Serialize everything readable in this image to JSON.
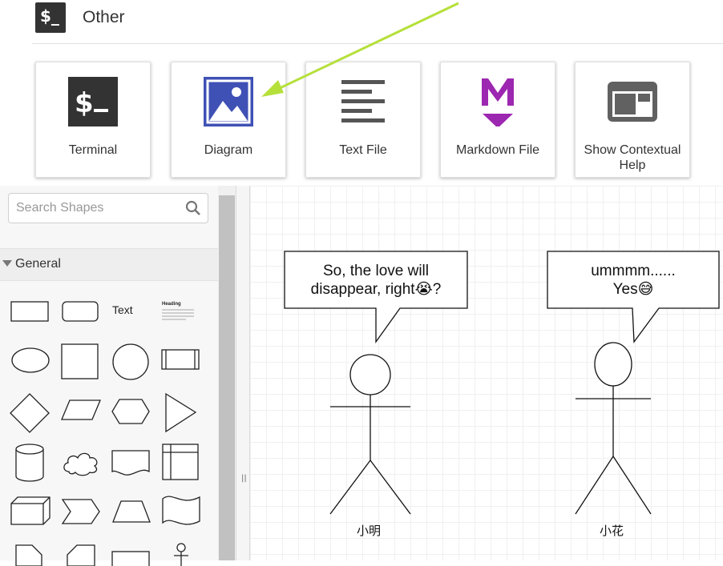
{
  "launcher": {
    "section_icon_text": "$_",
    "section_title": "Other",
    "cards": [
      {
        "label": "Terminal",
        "icon": "terminal-icon"
      },
      {
        "label": "Diagram",
        "icon": "image-icon",
        "accent": "#3f51b5"
      },
      {
        "label": "Text File",
        "icon": "text-lines-icon"
      },
      {
        "label": "Markdown File",
        "icon": "markdown-icon",
        "accent": "#9c27b0"
      },
      {
        "label": "Show Contextual Help",
        "icon": "help-layout-icon"
      }
    ],
    "annotation_arrow_color": "#b5e03a"
  },
  "shapes_panel": {
    "search": {
      "placeholder": "Search Shapes"
    },
    "section": {
      "label": "General",
      "expanded": true
    },
    "shapes": {
      "text_label": "Text",
      "heading_label": "Heading"
    }
  },
  "canvas": {
    "bubble_left": {
      "line1": "So, the love will",
      "line2": "disappear, right😭?"
    },
    "bubble_right": {
      "line1": "ummmm......",
      "line2": "Yes😅"
    },
    "actor_left": {
      "label": "小明"
    },
    "actor_right": {
      "label": "小花"
    }
  }
}
